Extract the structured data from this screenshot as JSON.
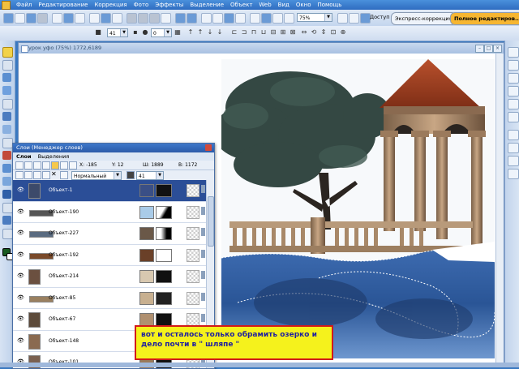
{
  "menu": {
    "items": [
      "Файл",
      "Редактирование",
      "Коррекция",
      "Фото",
      "Эффекты",
      "Выделение",
      "Объект",
      "Web",
      "Вид",
      "Окно",
      "Помощь"
    ]
  },
  "toolbar": {
    "zoom": "75%",
    "access": "Доступ",
    "mode_express": "Экспресс-коррекция",
    "mode_full": "Полное редактиров...",
    "brush_size": "41",
    "opacity": "0"
  },
  "document": {
    "title": "урок уфо (75%) 1772,6189"
  },
  "layers_panel": {
    "title": "Слои (Менеджер слоев)",
    "tabs": [
      "Слои",
      "Выделения"
    ],
    "x_label": "X:",
    "x_value": "-185",
    "y_label": "Y:",
    "y_value": "12",
    "w_label": "Ш:",
    "w_value": "1889",
    "h_label": "В:",
    "h_value": "1172",
    "blend_mode": "Нормальный",
    "opacity": "41",
    "rows": [
      {
        "name": "Объект-1",
        "selected": true
      },
      {
        "name": "Объект-190",
        "selected": false
      },
      {
        "name": "Объект-227",
        "selected": false
      },
      {
        "name": "Объект-192",
        "selected": false
      },
      {
        "name": "Объект-214",
        "selected": false
      },
      {
        "name": "Объект-85",
        "selected": false
      },
      {
        "name": "Объект-67",
        "selected": false
      },
      {
        "name": "Объект-148",
        "selected": false
      },
      {
        "name": "Объект-101",
        "selected": false
      }
    ]
  },
  "annotation": {
    "text": "вот и осталось только обрамить озерко и дело почти в \" шляпе \""
  },
  "colors": {
    "titlebar": "#2f6cc0",
    "selected_row": "#2b4e97",
    "annotation_bg": "#f5f21c",
    "annotation_border": "#d21a1a",
    "annotation_text": "#1f1fa0"
  }
}
